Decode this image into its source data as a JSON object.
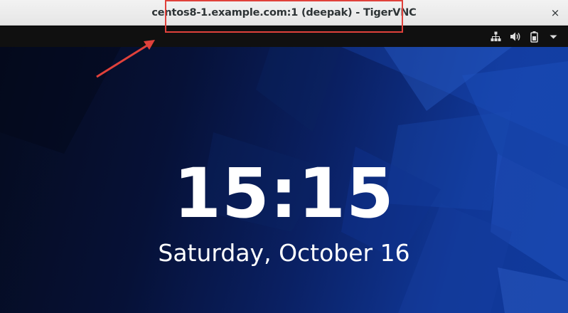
{
  "window": {
    "title": "centos8-1.example.com:1 (deepak) - TigerVNC",
    "close_glyph": "×"
  },
  "topbar": {
    "status_icons": [
      "network-icon",
      "volume-icon",
      "battery-icon",
      "system-menu-arrow-icon"
    ]
  },
  "lockscreen": {
    "time": "15:15",
    "date": "Saturday, October 16"
  },
  "colors": {
    "annotation": "#e0413b",
    "background_dark": "#061137",
    "background_light": "#103797"
  }
}
